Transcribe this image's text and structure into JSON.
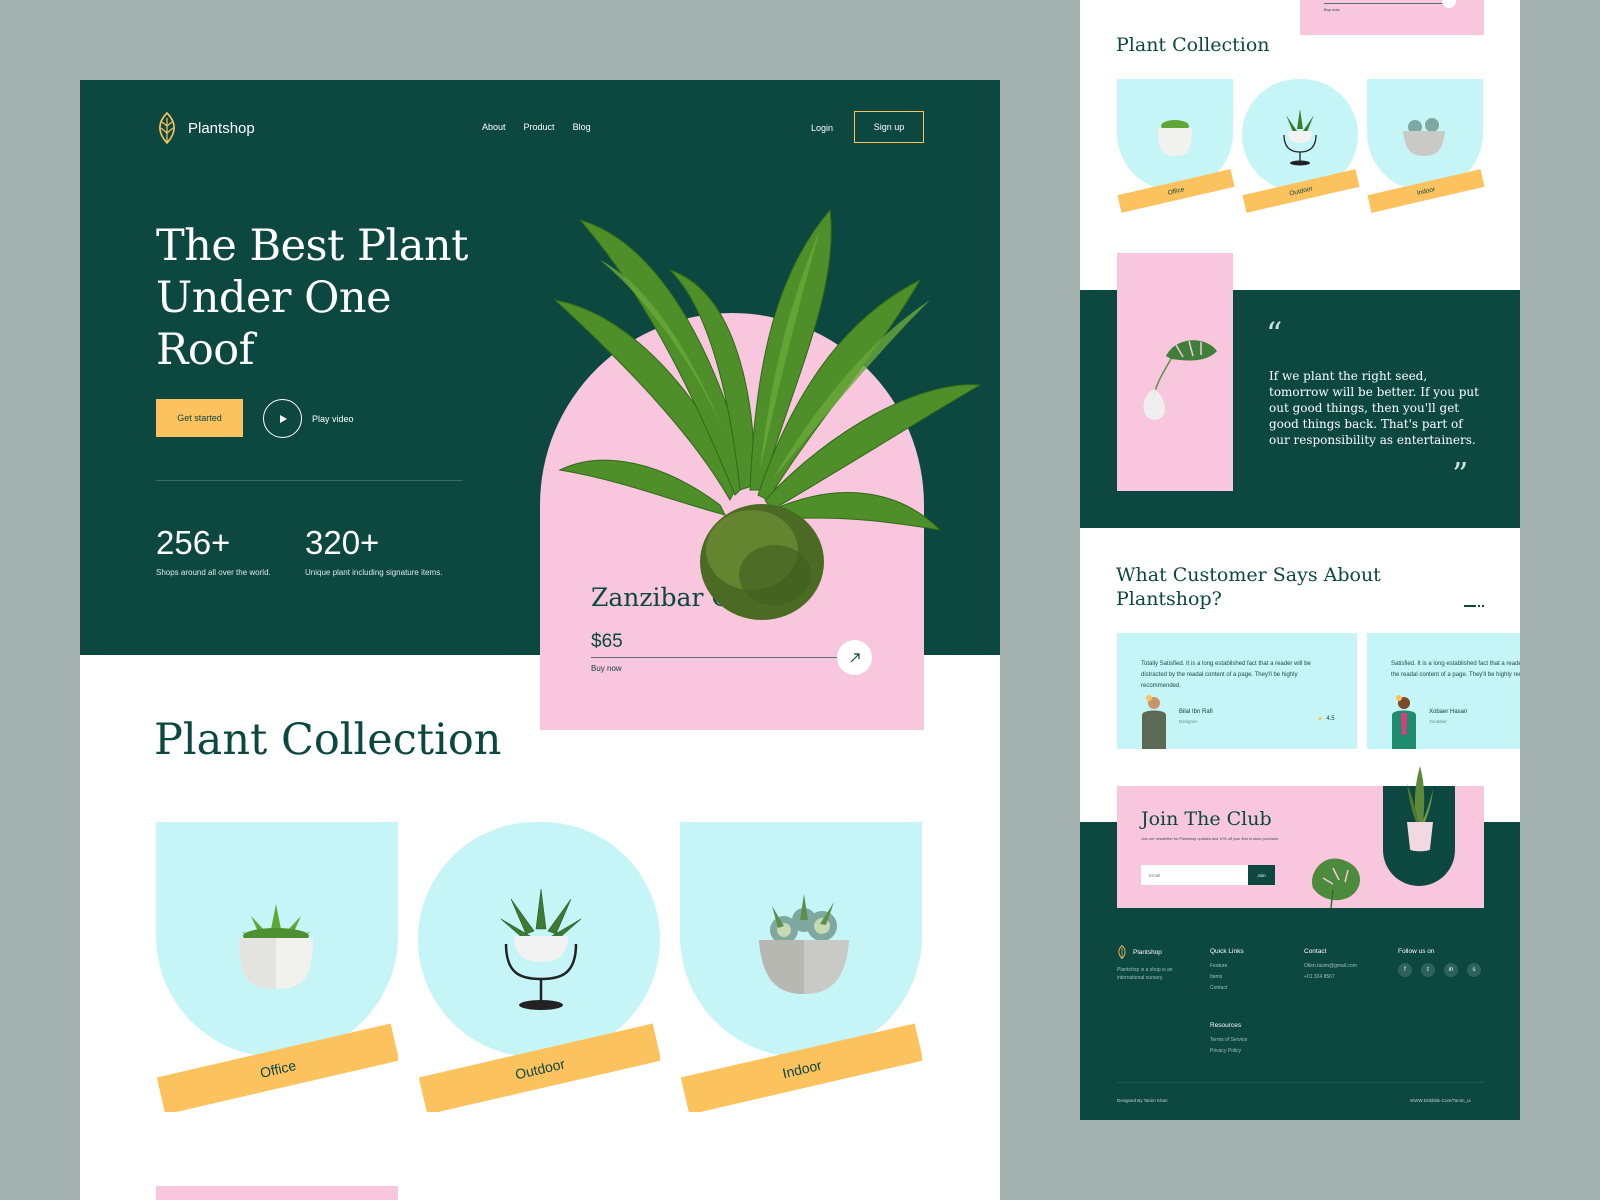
{
  "brand": {
    "name": "Plantshop"
  },
  "nav": {
    "links": [
      "About",
      "Product",
      "Blog"
    ],
    "login": "Login",
    "signup": "Sign up"
  },
  "hero": {
    "title_lines": [
      "The Best Plant",
      "Under One",
      "Roof"
    ],
    "cta": "Get started",
    "video": "Play video",
    "stats": [
      {
        "value": "256+",
        "caption": "Shops around all over the world."
      },
      {
        "value": "320+",
        "caption": "Unique plant including signature items."
      }
    ]
  },
  "product": {
    "name": "Zanzibar Gem",
    "price": "$65",
    "action": "Buy now"
  },
  "collection": {
    "title": "Plant Collection",
    "items": [
      "Office",
      "Outdoor",
      "Indoor"
    ]
  },
  "side": {
    "top_action": "Buy now",
    "collection_title": "Plant Collection",
    "collection_items": [
      "Office",
      "Outdoor",
      "Indoor"
    ],
    "quote": "If we plant the right seed, tomorrow will be better. If you put out good things, then you'll get good things back. That's part of our responsibility as entertainers.",
    "quote_open": "“",
    "quote_close": "”",
    "testimonials_title": "What Customer Says About Plantshop?",
    "testimonials": [
      {
        "text": "Totally Satisfied. It is a long established fact that a reader will be distracted by the readal content of a page. They'll be highly recommended.",
        "name": "Bilal Ibn Rafi",
        "role": "Designer",
        "rating": "4.5"
      },
      {
        "text": "Satisfied. It is a long established fact that a reader will be distracted by the readal content of a page. They'll be highly recommended to everyone.",
        "name": "Xobaer Hasan",
        "role": "Youtuber"
      }
    ],
    "club": {
      "title": "Join The Club",
      "text": "Join our newsletter for Plantshop updates and 10% off your first in-store purchase.",
      "email_placeholder": "Email",
      "button": "Join"
    },
    "footer": {
      "brand": "Plantshop",
      "about": "Plantshop is a shop is an international nursery.",
      "quick_links_title": "Quick Links",
      "quick_links": [
        "Feature",
        "Items",
        "Contact"
      ],
      "resources_title": "Resources",
      "resources": [
        "Terms of Service",
        "Privacy Policy"
      ],
      "contact_title": "Contact",
      "contact": [
        "Ollen.tasim@gmail.com",
        "+01 324 8567"
      ],
      "follow_title": "Follow us on",
      "socials": [
        "facebook-icon",
        "twitter-icon",
        "linkedin-icon",
        "skype-icon"
      ],
      "social_glyphs": [
        "f",
        "t",
        "in",
        "s"
      ],
      "credit": "Designed By Tanim Khan",
      "site": "WWW.Dribbble.Com/Tanim_ui"
    }
  },
  "colors": {
    "dark_green": "#0c4740",
    "pink": "#f8c6dd",
    "mint": "#c6f5f7",
    "yellow": "#fcc25e"
  }
}
